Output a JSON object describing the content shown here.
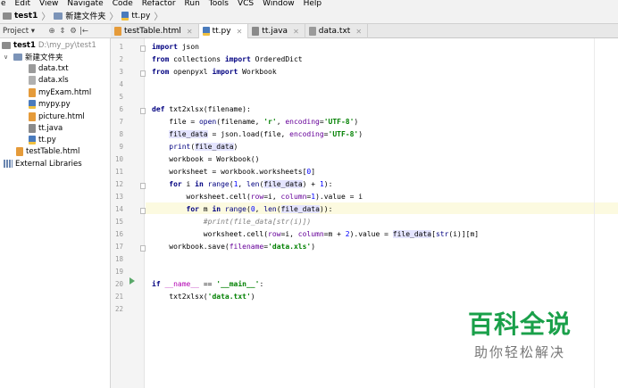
{
  "menu": [
    "e",
    "Edit",
    "View",
    "Navigate",
    "Code",
    "Refactor",
    "Run",
    "Tools",
    "VCS",
    "Window",
    "Help"
  ],
  "breadcrumb": {
    "project": "test1",
    "folder": "新建文件夹",
    "file": "tt.py"
  },
  "project_panel": {
    "title": "Project",
    "settings_glyph": "⚙",
    "target_glyph": "⊕",
    "split_glyph": "⇕",
    "hide_glyph": "|←"
  },
  "tabs": [
    {
      "label": "testTable.html",
      "icon": "html-file-icon",
      "active": false
    },
    {
      "label": "tt.py",
      "icon": "python-file-icon",
      "active": true
    },
    {
      "label": "tt.java",
      "icon": "java-file-icon",
      "active": false
    },
    {
      "label": "data.txt",
      "icon": "text-file-icon",
      "active": false
    }
  ],
  "tree": {
    "root_name": "test1",
    "root_path": "D:\\my_py\\test1",
    "folder": "新建文件夹",
    "files": [
      "data.txt",
      "data.xls",
      "myExam.html",
      "mypy.py",
      "picture.html",
      "tt.java",
      "tt.py"
    ],
    "root_file": "testTable.html",
    "external": "External Libraries"
  },
  "line_numbers": [
    "1",
    "2",
    "3",
    "4",
    "5",
    "6",
    "7",
    "8",
    "9",
    "10",
    "11",
    "12",
    "13",
    "14",
    "15",
    "16",
    "17",
    "18",
    "19",
    "20",
    "21",
    "22"
  ],
  "code": {
    "l1": [
      "import",
      " json"
    ],
    "l2": [
      "from",
      " collections ",
      "import",
      " OrderedDict"
    ],
    "l3": [
      "from",
      " openpyxl ",
      "import",
      " Workbook"
    ],
    "l6": [
      "def",
      " txt2xlsx(filename):"
    ],
    "l7": [
      "    file = ",
      "open",
      "(filename, ",
      "'r'",
      ", ",
      "encoding",
      "=",
      "'UTF-8'",
      ")"
    ],
    "l8": [
      "    ",
      "file_data",
      " = json.load(file, ",
      "encoding",
      "=",
      "'UTF-8'",
      ")"
    ],
    "l9": [
      "    ",
      "print",
      "(",
      "file_data",
      ")"
    ],
    "l10": [
      "    workbook = Workbook()"
    ],
    "l11": [
      "    worksheet = workbook.worksheets[",
      "0",
      "]"
    ],
    "l12": [
      "    ",
      "for",
      " i ",
      "in",
      " ",
      "range",
      "(",
      "1",
      ", ",
      "len",
      "(",
      "file_data",
      ") + ",
      "1",
      "):"
    ],
    "l13": [
      "        worksheet.cell(",
      "row",
      "=i, ",
      "column",
      "=",
      "1",
      ").value = i"
    ],
    "l14": [
      "        ",
      "for",
      " m ",
      "in",
      " ",
      "range",
      "(",
      "0",
      ", ",
      "len",
      "(",
      "file_data",
      ")):"
    ],
    "l15": [
      "            #print(file_data[str(i)])"
    ],
    "l16": [
      "            worksheet.cell(",
      "row",
      "=i, ",
      "column",
      "=m + ",
      "2",
      ").value = ",
      "file_data",
      "[",
      "str",
      "(i)][m]"
    ],
    "l17": [
      "    workbook.save(",
      "filename",
      "=",
      "'data.xls'",
      ")"
    ],
    "l20": [
      "if",
      " ",
      "__name__",
      " == ",
      "'__main__'",
      ":"
    ],
    "l21": [
      "    txt2xlsx(",
      "'data.txt'",
      ")"
    ]
  },
  "watermark": {
    "logo": "百科全说",
    "sub": "助你轻松解决"
  },
  "colors": {
    "keyword": "#000080",
    "string": "#008000",
    "kwarg": "#660099",
    "number": "#0000ff",
    "comment": "#808080",
    "current_line": "#fcfae0",
    "run_arrow": "#59a869",
    "watermark": "#1aa04a"
  }
}
